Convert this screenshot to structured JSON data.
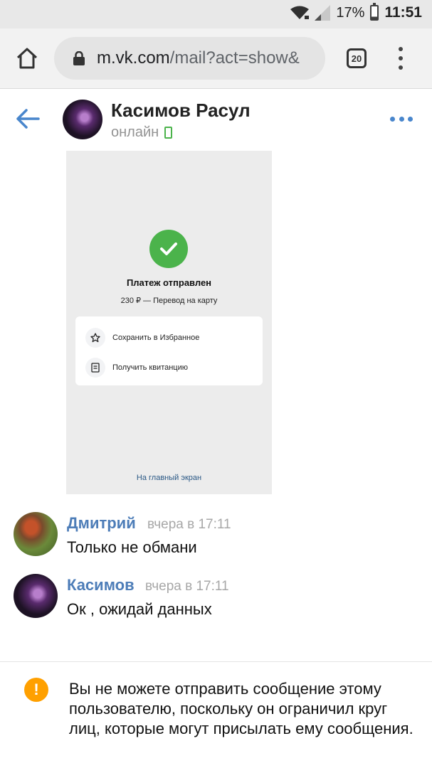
{
  "status_bar": {
    "battery_percent": "17%",
    "time": "11:51"
  },
  "browser": {
    "url_host": "m.vk.com",
    "url_path": "/mail?act=show&",
    "tab_count": "20"
  },
  "chat_header": {
    "name": "Касимов Расул",
    "status": "онлайн"
  },
  "attachment": {
    "title": "Платеж отправлен",
    "subtitle": "230 ₽ — Перевод на карту",
    "actions": [
      {
        "label": "Сохранить в Избранное",
        "icon": "star-icon"
      },
      {
        "label": "Получить квитанцию",
        "icon": "receipt-icon"
      }
    ],
    "home_link": "На главный экран",
    "colors": {
      "success": "#4bb34b",
      "link": "#2a5885"
    }
  },
  "messages": [
    {
      "author": "Дмитрий",
      "time": "вчера в 17:11",
      "text": "Только не обмани",
      "avatar": "red-panda-avatar"
    },
    {
      "author": "Касимов",
      "time": "вчера в 17:11",
      "text": "Ок , ожидай данных",
      "avatar": "dark-avatar"
    }
  ],
  "notice": {
    "text": "Вы не можете отправить сообщение этому пользователю, поскольку он ограничил круг лиц, которые могут присылать ему сообщения.",
    "icon": "warning-icon",
    "color": "#ffa000"
  },
  "colors": {
    "accent": "#4986cc",
    "author": "#4d7db8",
    "online": "#4bb34b"
  }
}
